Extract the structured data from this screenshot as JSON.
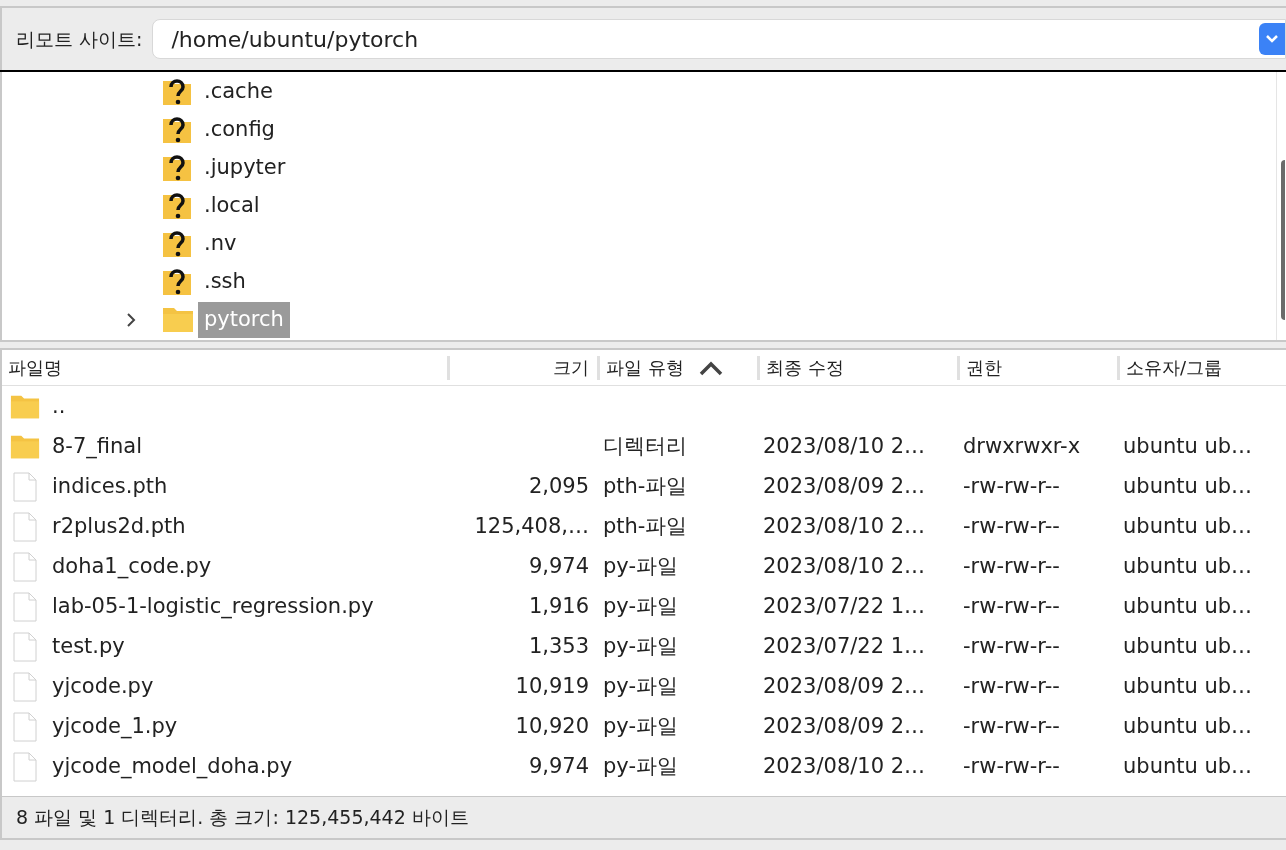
{
  "path_bar": {
    "label": "리모트 사이트:",
    "value": "/home/ubuntu/pytorch"
  },
  "tree": [
    {
      "label": ".cache",
      "kind": "unknown",
      "expandable": false,
      "selected": false
    },
    {
      "label": ".config",
      "kind": "unknown",
      "expandable": false,
      "selected": false
    },
    {
      "label": ".jupyter",
      "kind": "unknown",
      "expandable": false,
      "selected": false
    },
    {
      "label": ".local",
      "kind": "unknown",
      "expandable": false,
      "selected": false
    },
    {
      "label": ".nv",
      "kind": "unknown",
      "expandable": false,
      "selected": false
    },
    {
      "label": ".ssh",
      "kind": "unknown",
      "expandable": false,
      "selected": false
    },
    {
      "label": "pytorch",
      "kind": "folder",
      "expandable": true,
      "selected": true
    }
  ],
  "table": {
    "columns": [
      {
        "label": "파일명",
        "sorted": false
      },
      {
        "label": "크기",
        "sorted": false
      },
      {
        "label": "파일 유형",
        "sorted": true
      },
      {
        "label": "최종 수정",
        "sorted": false
      },
      {
        "label": "권한",
        "sorted": false
      },
      {
        "label": "소유자/그룹",
        "sorted": false
      }
    ],
    "rows": [
      {
        "kind": "folder",
        "cells": [
          "..",
          "",
          "",
          "",
          "",
          ""
        ]
      },
      {
        "kind": "folder",
        "cells": [
          "8-7_final",
          "",
          "디렉터리",
          "2023/08/10 2…",
          "drwxrwxr-x",
          "ubuntu ub…"
        ]
      },
      {
        "kind": "file",
        "cells": [
          "indices.pth",
          "2,095",
          "pth-파일",
          "2023/08/09 2…",
          "-rw-rw-r--",
          "ubuntu ub…"
        ]
      },
      {
        "kind": "file",
        "cells": [
          "r2plus2d.pth",
          "125,408,…",
          "pth-파일",
          "2023/08/10 2…",
          "-rw-rw-r--",
          "ubuntu ub…"
        ]
      },
      {
        "kind": "file",
        "cells": [
          "doha1_code.py",
          "9,974",
          "py-파일",
          "2023/08/10 2…",
          "-rw-rw-r--",
          "ubuntu ub…"
        ]
      },
      {
        "kind": "file",
        "cells": [
          "lab-05-1-logistic_regression.py",
          "1,916",
          "py-파일",
          "2023/07/22 1…",
          "-rw-rw-r--",
          "ubuntu ub…"
        ]
      },
      {
        "kind": "file",
        "cells": [
          "test.py",
          "1,353",
          "py-파일",
          "2023/07/22 1…",
          "-rw-rw-r--",
          "ubuntu ub…"
        ]
      },
      {
        "kind": "file",
        "cells": [
          "yjcode.py",
          "10,919",
          "py-파일",
          "2023/08/09 2…",
          "-rw-rw-r--",
          "ubuntu ub…"
        ]
      },
      {
        "kind": "file",
        "cells": [
          "yjcode_1.py",
          "10,920",
          "py-파일",
          "2023/08/09 2…",
          "-rw-rw-r--",
          "ubuntu ub…"
        ]
      },
      {
        "kind": "file",
        "cells": [
          "yjcode_model_doha.py",
          "9,974",
          "py-파일",
          "2023/08/10 2…",
          "-rw-rw-r--",
          "ubuntu ub…"
        ]
      }
    ]
  },
  "status_bar": "8 파일 및 1 디렉터리. 총 크기: 125,455,442 바이트"
}
